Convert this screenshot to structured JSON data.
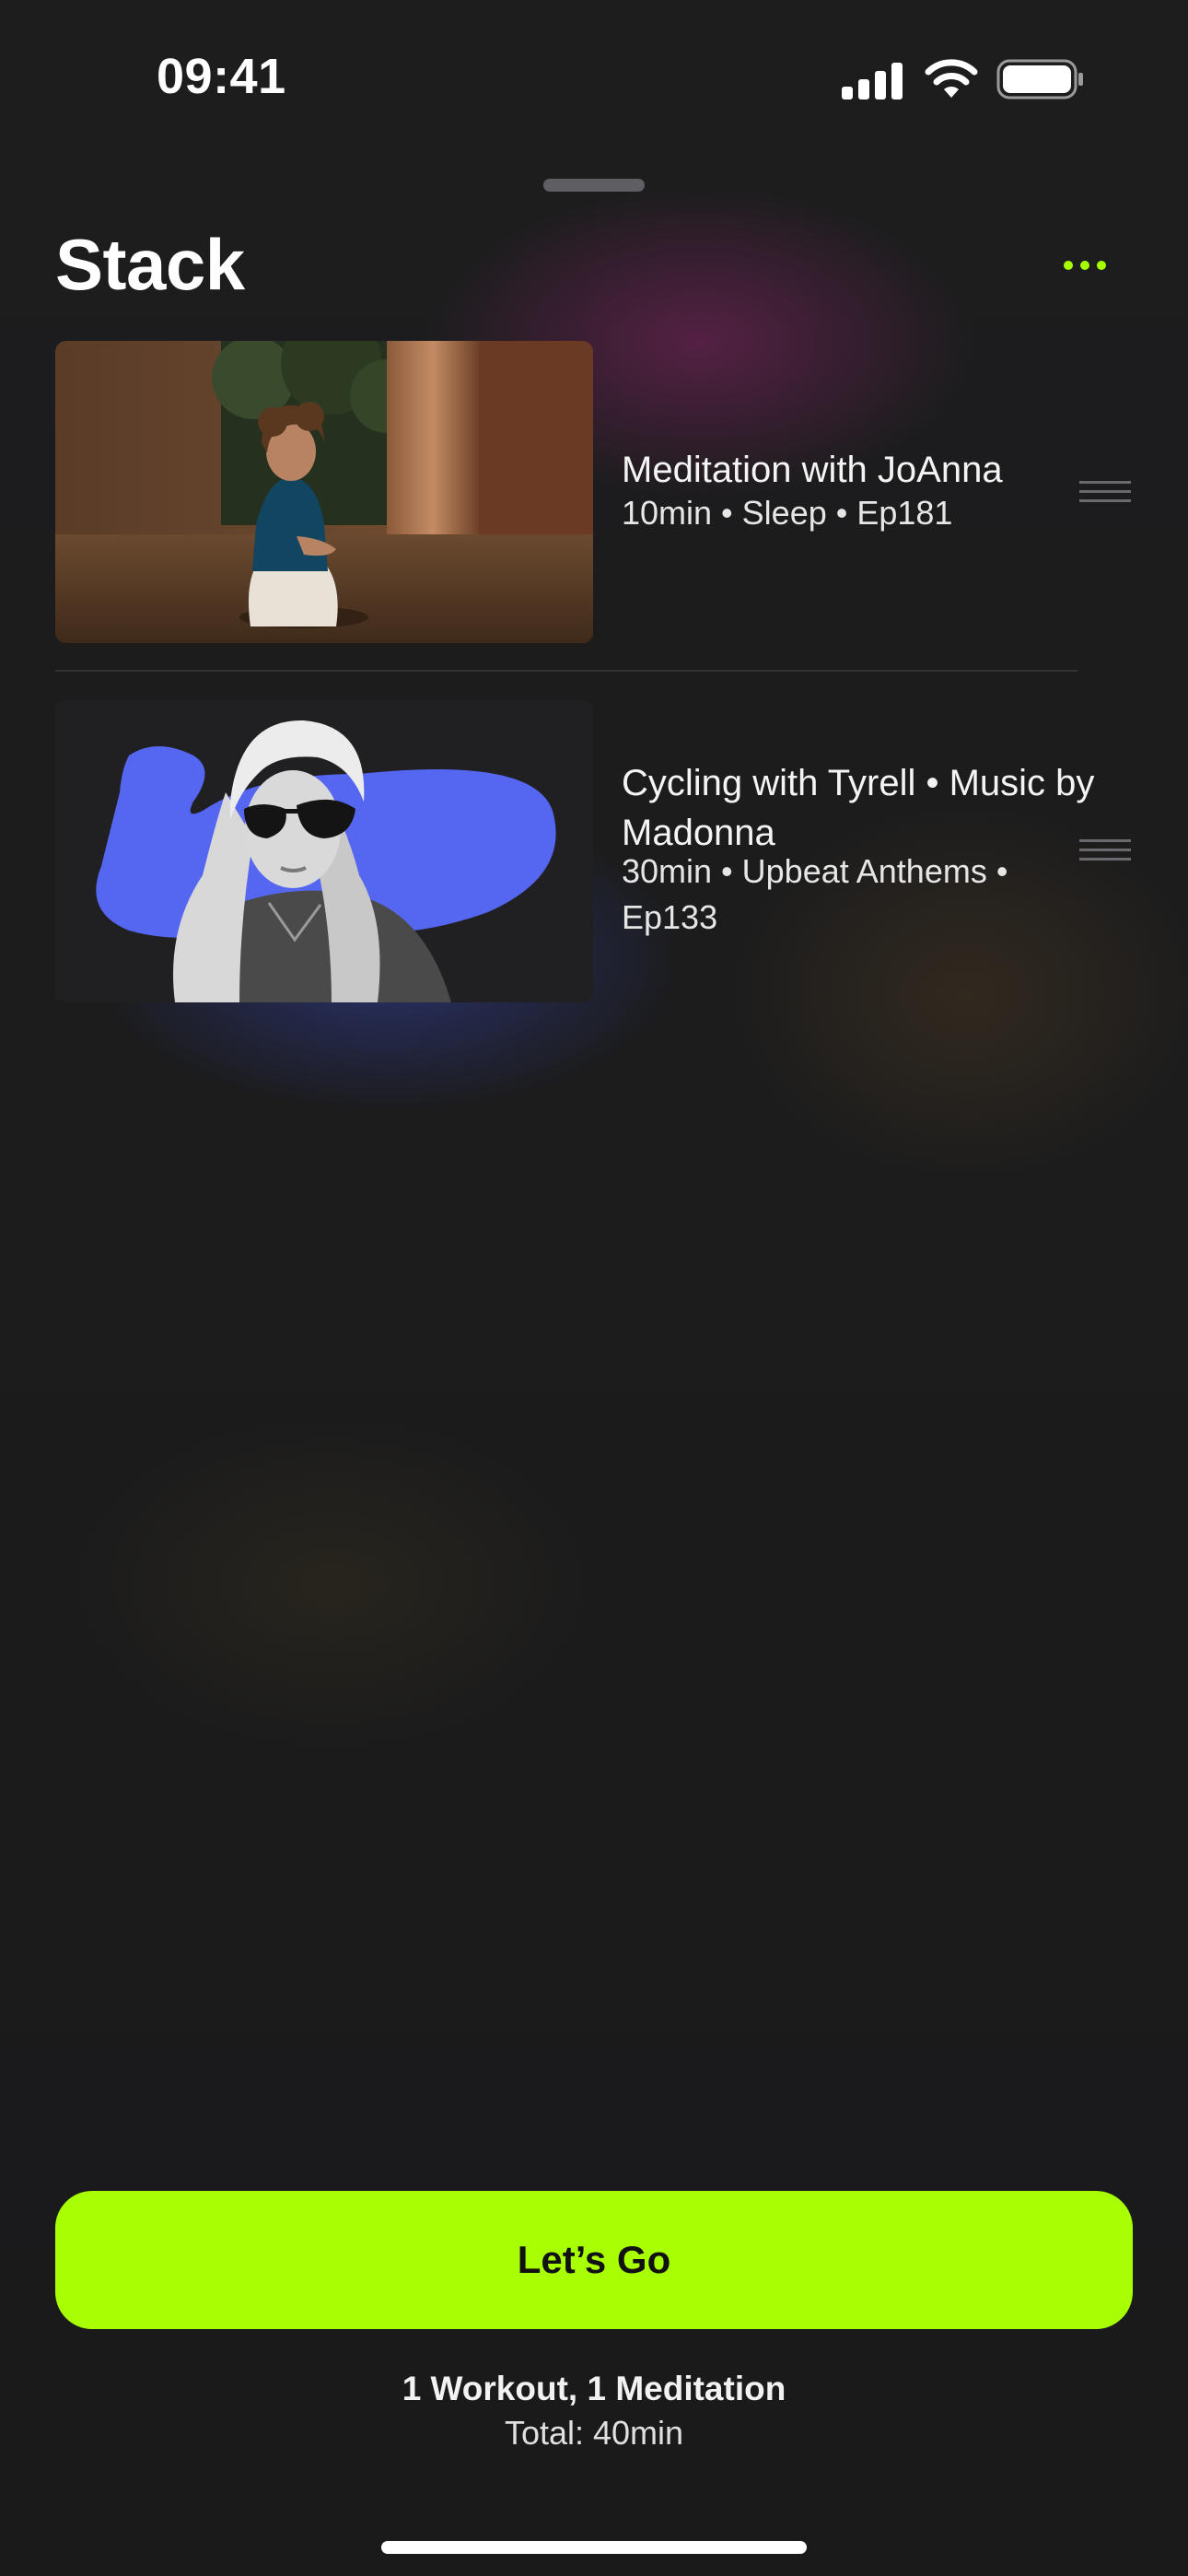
{
  "status_bar": {
    "time": "09:41",
    "icons": [
      "signal-icon",
      "wifi-icon",
      "battery-icon"
    ]
  },
  "header": {
    "title": "Stack",
    "more_icon": "ellipsis-icon"
  },
  "items": [
    {
      "title": "Meditation with JoAnna",
      "subtitle": "10min • Sleep • Ep181",
      "handle_icon": "drag-handle-icon"
    },
    {
      "title": "Cycling with Tyrell • Music by Madonna",
      "subtitle": "30min • Upbeat Anthems • Ep133",
      "handle_icon": "drag-handle-icon"
    }
  ],
  "cta": {
    "label": "Let’s Go"
  },
  "summary": {
    "counts": "1 Workout, 1 Meditation",
    "total": "Total: 40min"
  },
  "colors": {
    "accent": "#a8ff04",
    "background": "#1b1b1c",
    "artwork_blue": "#5566f0"
  }
}
